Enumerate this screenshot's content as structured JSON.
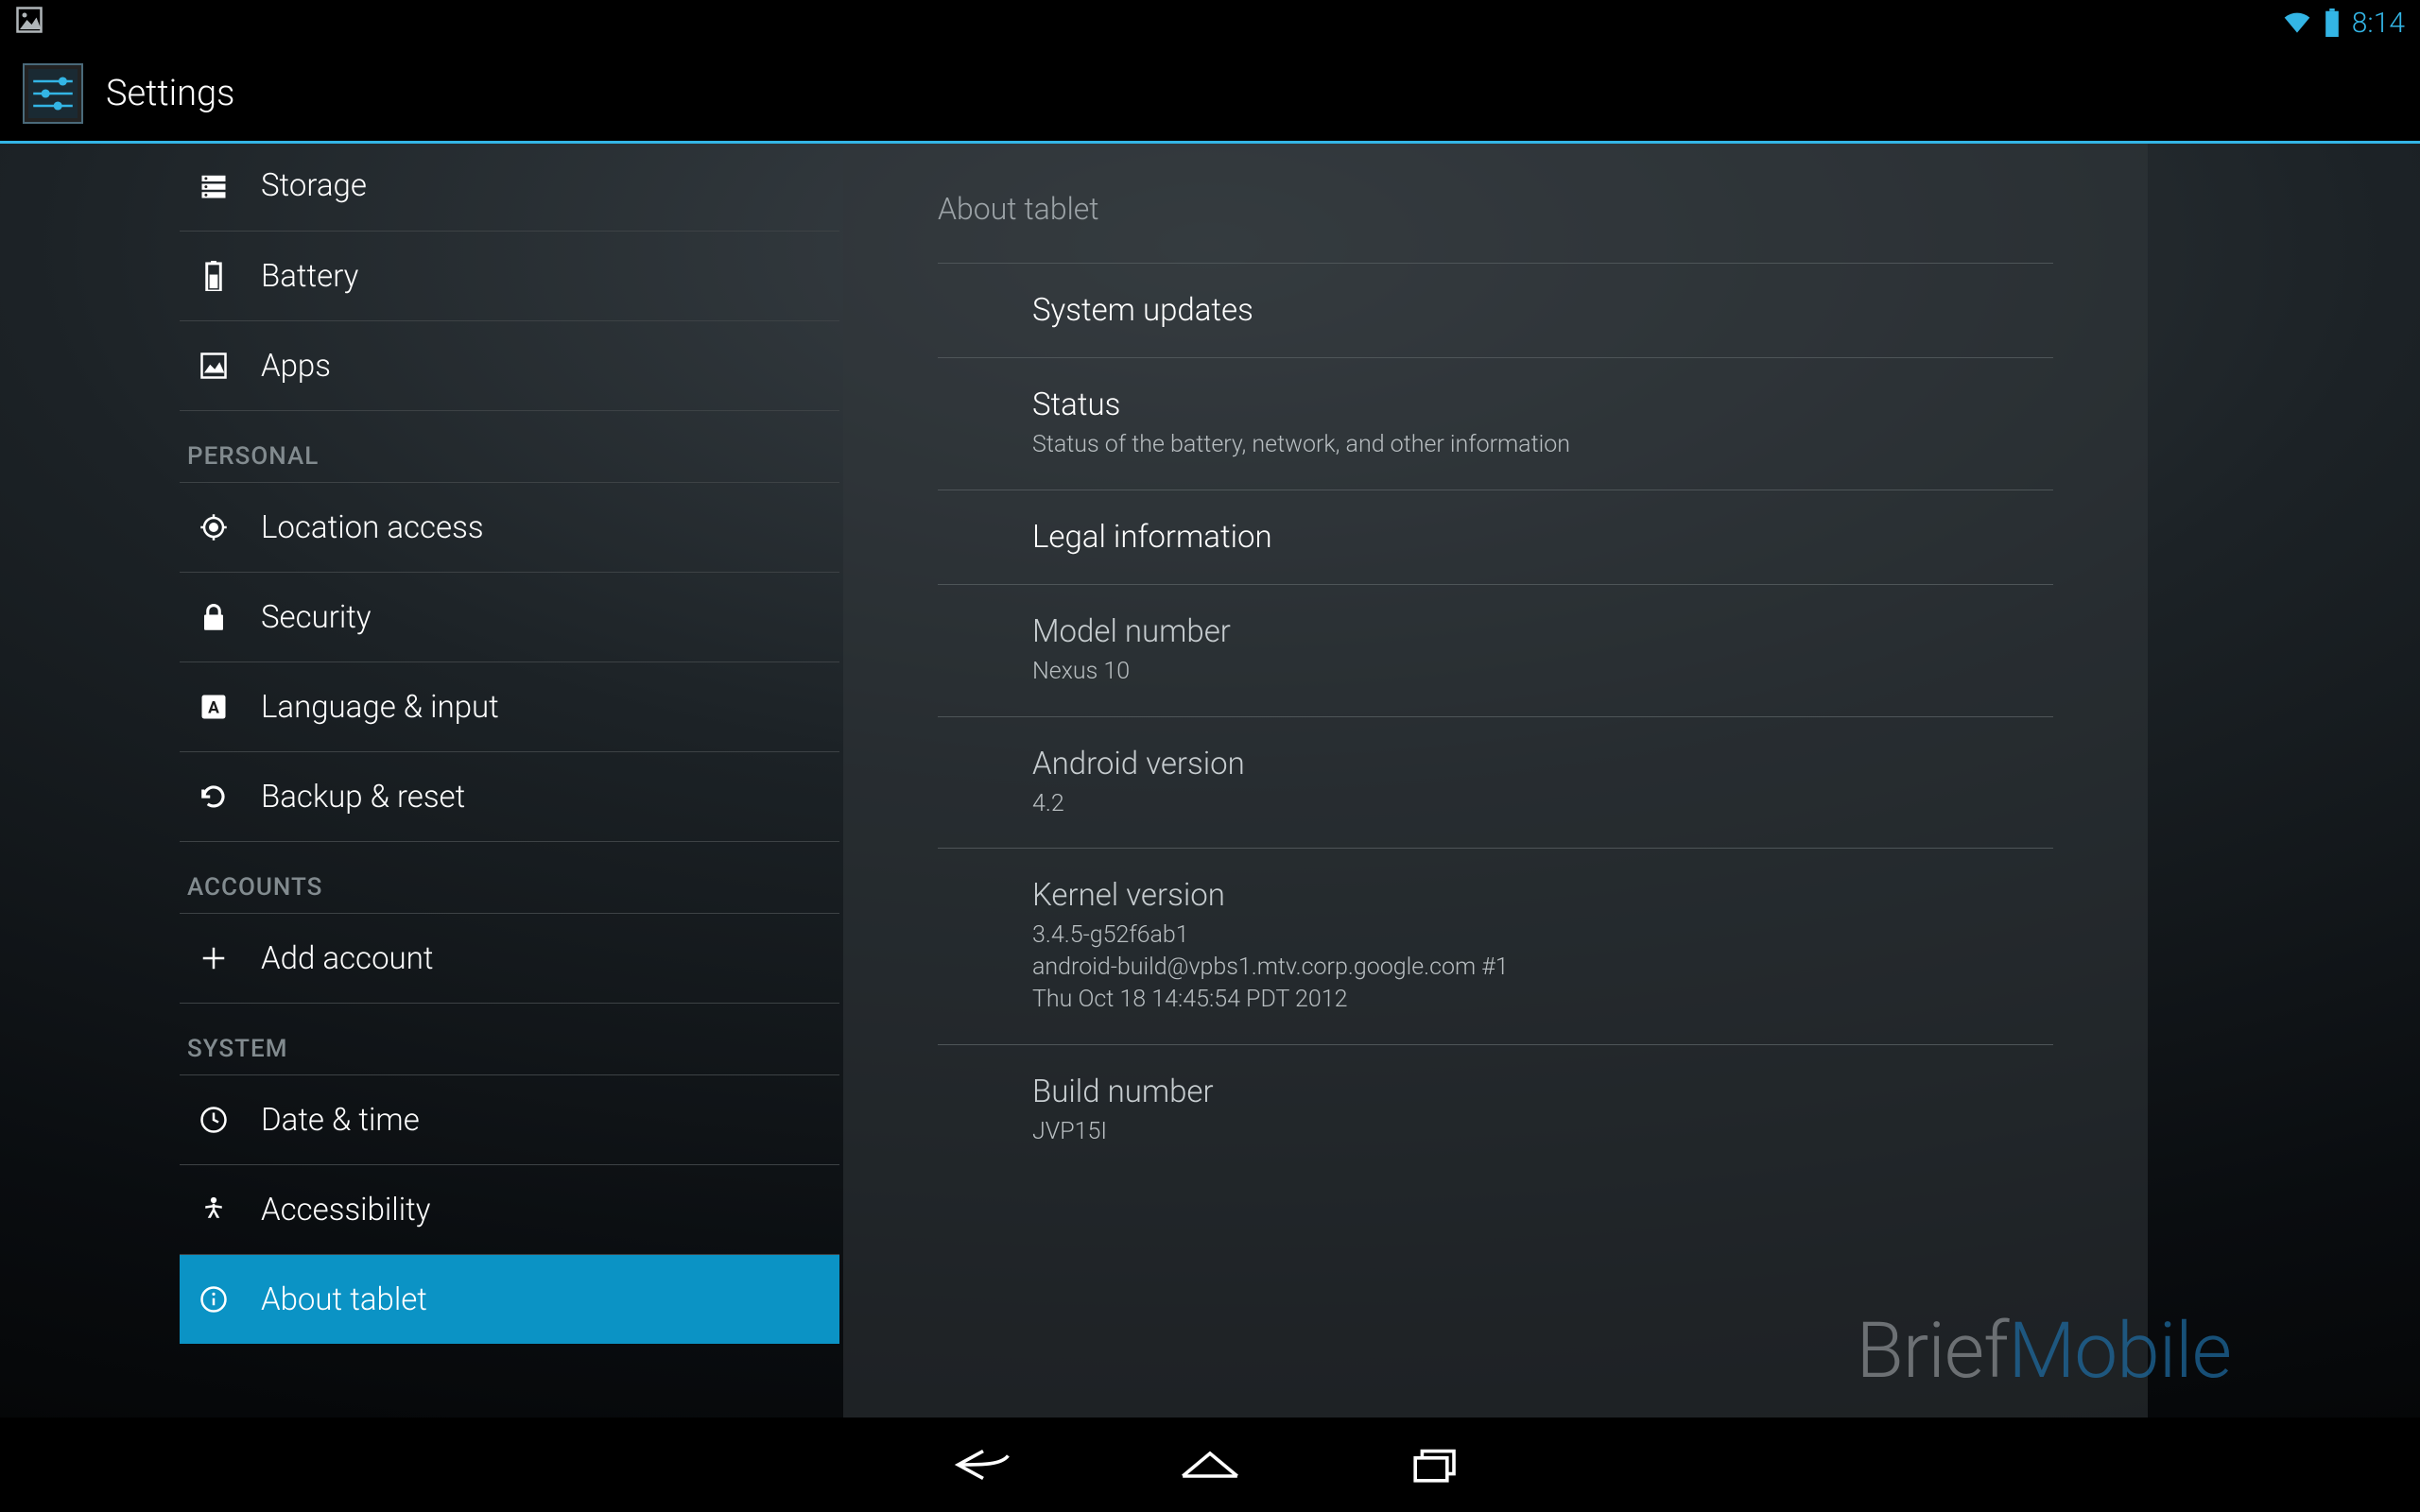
{
  "status": {
    "time": "8:14"
  },
  "header": {
    "title": "Settings"
  },
  "sidebar": {
    "items": [
      {
        "label": "Storage",
        "icon": "storage"
      },
      {
        "label": "Battery",
        "icon": "battery"
      },
      {
        "label": "Apps",
        "icon": "apps"
      }
    ],
    "section_personal": "PERSONAL",
    "personal": [
      {
        "label": "Location access",
        "icon": "location"
      },
      {
        "label": "Security",
        "icon": "lock"
      },
      {
        "label": "Language & input",
        "icon": "language"
      },
      {
        "label": "Backup & reset",
        "icon": "backup"
      }
    ],
    "section_accounts": "ACCOUNTS",
    "accounts": [
      {
        "label": "Add account",
        "icon": "add"
      }
    ],
    "section_system": "SYSTEM",
    "system": [
      {
        "label": "Date & time",
        "icon": "clock"
      },
      {
        "label": "Accessibility",
        "icon": "accessibility"
      },
      {
        "label": "About tablet",
        "icon": "info",
        "selected": true
      }
    ]
  },
  "main": {
    "header": "About tablet",
    "items": [
      {
        "title": "System updates"
      },
      {
        "title": "Status",
        "sub": "Status of the battery, network, and other information"
      },
      {
        "title": "Legal information"
      },
      {
        "title": "Model number",
        "sub": "Nexus 10",
        "dim": true
      },
      {
        "title": "Android version",
        "sub": "4.2",
        "dim": true
      },
      {
        "title": "Kernel version",
        "sub": "3.4.5-g52f6ab1\nandroid-build@vpbs1.mtv.corp.google.com #1\nThu Oct 18 14:45:54 PDT 2012",
        "dim": true
      },
      {
        "title": "Build number",
        "sub": "JVP15I",
        "dim": true
      }
    ]
  },
  "watermark": {
    "a": "Brief",
    "b": "Mobile"
  }
}
